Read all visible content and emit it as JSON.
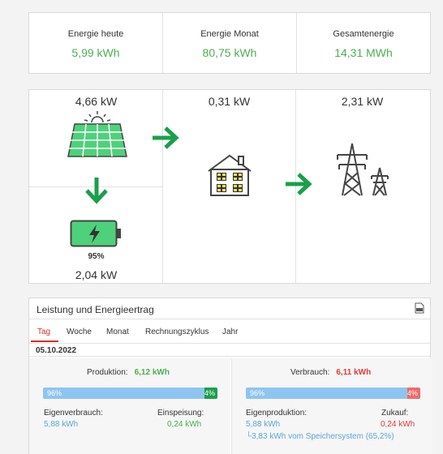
{
  "summary": {
    "items": [
      {
        "label": "Energie heute",
        "value": "5,99 kWh"
      },
      {
        "label": "Energie Monat",
        "value": "80,75 kWh"
      },
      {
        "label": "Gesamtenergie",
        "value": "14,31 MWh"
      }
    ]
  },
  "flow": {
    "pv_power": "4,66 kW",
    "house_power": "0,31 kW",
    "grid_power": "2,31 kW",
    "battery_soc": "95%",
    "battery_power": "2,04 kW",
    "arrow_color": "#18a04a"
  },
  "performance": {
    "title": "Leistung und Energieertrag",
    "tabs": [
      "Tag",
      "Woche",
      "Monat",
      "Rechnungszyklus",
      "Jahr"
    ],
    "active_tab": "Tag",
    "date": "05.10.2022",
    "production": {
      "label": "Produktion:",
      "value": "6,12 kWh",
      "bar_main_label": "96%",
      "bar_rest_label": "4%",
      "share": 0.96,
      "left_label": "Eigenverbrauch:",
      "left_value": "5,88 kWh",
      "right_label": "Einspeisung:",
      "right_value": "0,24 kWh"
    },
    "consumption": {
      "label": "Verbrauch:",
      "value": "6,11 kWh",
      "bar_main_label": "96%",
      "bar_rest_label": "4%",
      "share": 0.96,
      "left_label": "Eigenproduktion:",
      "left_value": "5,88 kWh",
      "right_label": "Zukauf:",
      "right_value": "0,24 kWh",
      "storage_note": "3,83 kWh vom Speichersystem (65,2%)"
    }
  },
  "colors": {
    "green": "#4caf50",
    "red": "#e53935",
    "blue": "#5aa6e0"
  }
}
